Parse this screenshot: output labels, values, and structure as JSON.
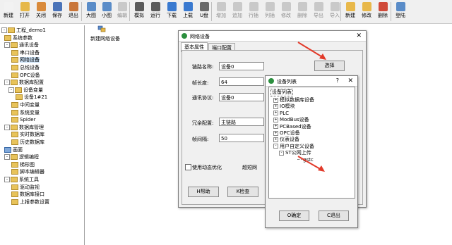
{
  "toolbar": {
    "buttons": [
      {
        "label": "新建",
        "icon": "new-file-icon",
        "color": "#f2f2f2",
        "enabled": true
      },
      {
        "label": "打开",
        "icon": "folder-open-icon",
        "color": "#e6b84a",
        "enabled": true
      },
      {
        "label": "关闭",
        "icon": "close-file-icon",
        "color": "#d98a3a",
        "enabled": true
      },
      {
        "label": "保存",
        "icon": "save-icon",
        "color": "#4a73b8",
        "enabled": true
      },
      {
        "label": "退出",
        "icon": "exit-icon",
        "color": "#c9763a",
        "enabled": true
      },
      {
        "label": "大图",
        "icon": "large-icons-icon",
        "color": "#5a8cc8",
        "enabled": true
      },
      {
        "label": "小图",
        "icon": "small-icons-icon",
        "color": "#5a8cc8",
        "enabled": true
      },
      {
        "label": "编辑",
        "icon": "edit-icon",
        "color": "#9a9a9a",
        "enabled": false
      },
      {
        "label": "模拟",
        "icon": "simulate-icon",
        "color": "#5a5a5a",
        "enabled": true
      },
      {
        "label": "运行",
        "icon": "run-icon",
        "color": "#5a5a5a",
        "enabled": true
      },
      {
        "label": "下载",
        "icon": "download-icon",
        "color": "#3a7ad0",
        "enabled": true
      },
      {
        "label": "上载",
        "icon": "upload-icon",
        "color": "#3a7ad0",
        "enabled": true
      },
      {
        "label": "U盘",
        "icon": "usb-drive-icon",
        "color": "#6a6a6a",
        "enabled": true
      },
      {
        "label": "增加",
        "icon": "add-icon",
        "color": "#9a9a9a",
        "enabled": false
      },
      {
        "label": "追加",
        "icon": "append-icon",
        "color": "#9a9a9a",
        "enabled": false
      },
      {
        "label": "行插",
        "icon": "insert-row-icon",
        "color": "#9a9a9a",
        "enabled": false
      },
      {
        "label": "列插",
        "icon": "insert-column-icon",
        "color": "#9a9a9a",
        "enabled": false
      },
      {
        "label": "修改",
        "icon": "modify-icon",
        "color": "#9a9a9a",
        "enabled": false
      },
      {
        "label": "删除",
        "icon": "delete-icon",
        "color": "#9a9a9a",
        "enabled": false
      },
      {
        "label": "导出",
        "icon": "export-icon",
        "color": "#9a9a9a",
        "enabled": false
      },
      {
        "label": "导入",
        "icon": "import-icon",
        "color": "#9a9a9a",
        "enabled": false
      },
      {
        "label": "新建",
        "icon": "new-item-icon",
        "color": "#e8b84a",
        "enabled": true
      },
      {
        "label": "修改",
        "icon": "modify-item-icon",
        "color": "#e8b84a",
        "enabled": true
      },
      {
        "label": "删除",
        "icon": "delete-item-icon",
        "color": "#d04a3a",
        "enabled": true
      },
      {
        "label": "登陆",
        "icon": "login-icon",
        "color": "#5a8cc8",
        "enabled": true
      }
    ]
  },
  "tree": {
    "items": [
      {
        "label": "工程_demo1",
        "exp": "-",
        "type": "project"
      },
      {
        "label": "系统参数",
        "exp": "",
        "type": "folder"
      },
      {
        "label": "通讯设备",
        "exp": "-",
        "type": "folder"
      },
      {
        "label": "串口设备",
        "exp": "",
        "type": "item"
      },
      {
        "label": "网络设备",
        "exp": "",
        "type": "item"
      },
      {
        "label": "总线设备",
        "exp": "",
        "type": "item"
      },
      {
        "label": "OPC设备",
        "exp": "",
        "type": "item"
      },
      {
        "label": "数据库配置",
        "exp": "-",
        "type": "folder"
      },
      {
        "label": "设备变量",
        "exp": "-",
        "type": "folder"
      },
      {
        "label": "设备1#21",
        "exp": "",
        "type": "item"
      },
      {
        "label": "中间变量",
        "exp": "",
        "type": "item"
      },
      {
        "label": "系统变量",
        "exp": "",
        "type": "item"
      },
      {
        "label": "Spider",
        "exp": "",
        "type": "item"
      },
      {
        "label": "数据库管理",
        "exp": "-",
        "type": "folder"
      },
      {
        "label": "实时数据库",
        "exp": "",
        "type": "item"
      },
      {
        "label": "历史数据库",
        "exp": "",
        "type": "item"
      },
      {
        "label": "画面",
        "exp": "",
        "type": "blue"
      },
      {
        "label": "逻辑编程",
        "exp": "-",
        "type": "folder"
      },
      {
        "label": "梯形图",
        "exp": "",
        "type": "item"
      },
      {
        "label": "脚本编辑器",
        "exp": "",
        "type": "item"
      },
      {
        "label": "系统工具",
        "exp": "-",
        "type": "folder"
      },
      {
        "label": "驱动监视",
        "exp": "",
        "type": "item"
      },
      {
        "label": "数据库接口",
        "exp": "",
        "type": "item"
      },
      {
        "label": "上报参数设置",
        "exp": "",
        "type": "item"
      }
    ]
  },
  "workspace": {
    "device_label": "新建网络设备"
  },
  "net_dialog": {
    "title": "网络设备",
    "tabs": [
      "基本属性",
      "端口配置"
    ],
    "link_name_label": "链路名称:",
    "link_name_value": "设备0",
    "select_button": "选择",
    "frame_len_label": "帧长度:",
    "frame_len_value": "64",
    "protocol_label": "通讯协议:",
    "protocol_value": "设备0",
    "redundancy_label": "冗余配置:",
    "redundancy_value": "主链路",
    "frame_interval_label": "帧间隔:",
    "frame_interval_value": "50",
    "unit_ms": "ms",
    "dynamic_opt_label": "使用动态优化",
    "timeout_label": "超短网",
    "help_button": "H帮助",
    "check_button": "K检查"
  },
  "device_list_dialog": {
    "title": "设备列表",
    "help_glyph": "?",
    "root_label": "设备列表",
    "items": [
      {
        "label": "模拟数据库设备",
        "exp": "+",
        "level": 1
      },
      {
        "label": "IO模块",
        "exp": "+",
        "level": 1
      },
      {
        "label": "PLC",
        "exp": "+",
        "level": 1
      },
      {
        "label": "ModBus设备",
        "exp": "+",
        "level": 1
      },
      {
        "label": "PCBased设备",
        "exp": "+",
        "level": 1
      },
      {
        "label": "OPC设备",
        "exp": "+",
        "level": 1
      },
      {
        "label": "仪表设备",
        "exp": "+",
        "level": 1
      },
      {
        "label": "用户自定义设备",
        "exp": "-",
        "level": 1
      },
      {
        "label": "ST公网上传",
        "exp": "-",
        "level": 2
      },
      {
        "label": "gstc",
        "exp": "",
        "level": 3
      }
    ],
    "ok_button": "O确定",
    "cancel_button": "C退出"
  },
  "colors": {
    "arrow": "#e23a2a",
    "title_icon": "#2b8f3e",
    "selection": "#cde3f8"
  }
}
